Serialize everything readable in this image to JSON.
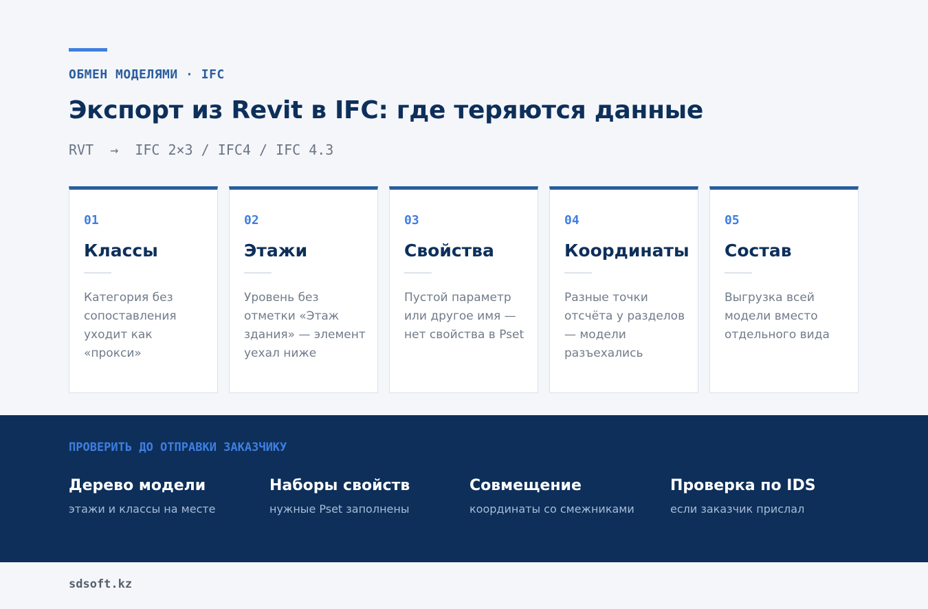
{
  "header": {
    "eyebrow": "ОБМЕН МОДЕЛЯМИ · IFC",
    "title": "Экспорт из Revit в IFC: где теряются данные",
    "formats": "RVT  →  IFC 2×3 / IFC4 / IFC 4.3"
  },
  "cards": [
    {
      "num": "01",
      "title": "Классы",
      "desc": "Категория без сопоставления уходит как «прокси»"
    },
    {
      "num": "02",
      "title": "Этажи",
      "desc": "Уровень без отметки «Этаж здания» — элемент уехал ниже"
    },
    {
      "num": "03",
      "title": "Свойства",
      "desc": "Пустой параметр или другое имя — нет свойства в Pset"
    },
    {
      "num": "04",
      "title": "Координаты",
      "desc": "Разные точки отсчёта у разделов — модели разъехались"
    },
    {
      "num": "05",
      "title": "Состав",
      "desc": "Выгрузка всей модели вместо отдельного вида"
    }
  ],
  "checklist": {
    "label": "ПРОВЕРИТЬ ДО ОТПРАВКИ ЗАКАЗЧИКУ",
    "items": [
      {
        "title": "Дерево модели",
        "sub": "этажи и классы на месте"
      },
      {
        "title": "Наборы свойств",
        "sub": "нужные Pset заполнены"
      },
      {
        "title": "Совмещение",
        "sub": "координаты со смежниками"
      },
      {
        "title": "Проверка по IDS",
        "sub": "если заказчик прислал"
      }
    ]
  },
  "footer": {
    "site": "sdsoft.kz"
  },
  "colors": {
    "navy": "#0d2f5a",
    "accent": "#3f7fe0",
    "background": "#f4f6fa"
  }
}
